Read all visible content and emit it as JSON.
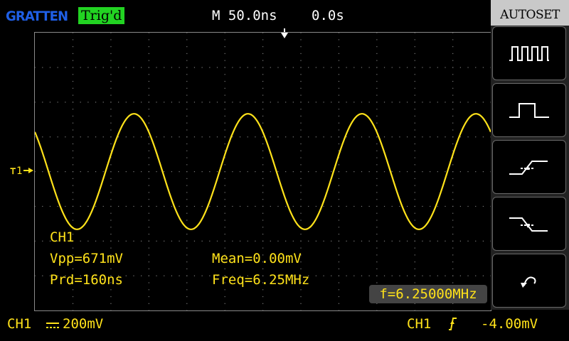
{
  "header": {
    "brand": "GRATTEN",
    "trigger_status": "Trig'd",
    "timebase": "M 50.0ns",
    "horizontal_offset": "0.0s"
  },
  "colors": {
    "trace": "#ffe21a",
    "trig_status_bg": "#22d322",
    "brand": "#1f5fe6",
    "panel_bg": "#000000"
  },
  "channel_marker": {
    "label": "1",
    "icon": "ground-arrow-icon"
  },
  "measurements": {
    "channel": "CH1",
    "vpp": "Vpp=671mV",
    "mean": "Mean=0.00mV",
    "period": "Prd=160ns",
    "freq": "Freq=6.25MHz",
    "frequency_counter": "f=6.25000MHz"
  },
  "bottom": {
    "channel": "CH1",
    "coupling_icon": "dc-coupling-icon",
    "volts_div": "200mV",
    "trigger_source": "CH1",
    "trigger_slope_icon": "rising-edge-icon",
    "trigger_level": "-4.00mV"
  },
  "menu": {
    "title": "AUTOSET",
    "buttons": [
      {
        "icon": "multi-period-icon"
      },
      {
        "icon": "single-period-icon"
      },
      {
        "icon": "rising-edge-icon"
      },
      {
        "icon": "falling-edge-icon"
      },
      {
        "icon": "undo-icon"
      }
    ]
  },
  "waveform": {
    "type": "sine",
    "frequency": "6.25MHz",
    "period": "160ns",
    "vpp": "671mV",
    "time_per_div": "50.0ns",
    "volts_per_div": "200mV",
    "divisions_horizontal": 12,
    "divisions_vertical": 8,
    "cycles_visible": 4
  }
}
